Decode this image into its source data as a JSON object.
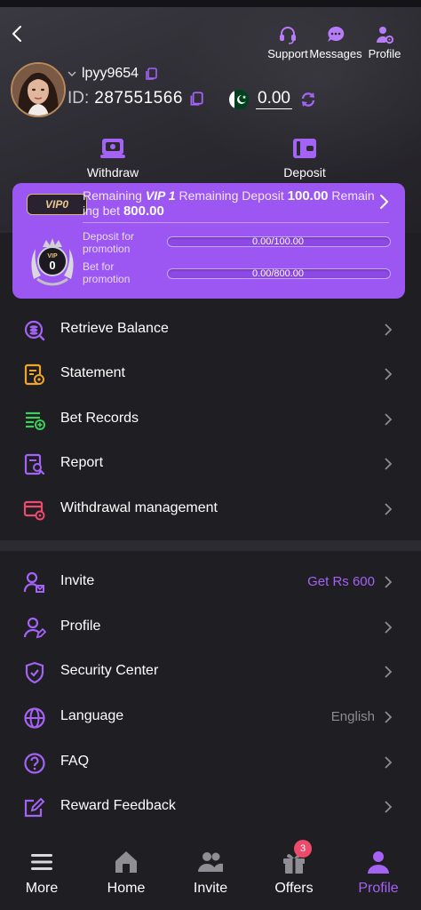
{
  "header": {
    "actions": [
      {
        "label": "Support",
        "icon": "headset-icon"
      },
      {
        "label": "Messages",
        "icon": "chat-bubble-icon"
      },
      {
        "label": "Profile",
        "icon": "user-gear-icon"
      }
    ],
    "username": "lpyy9654",
    "id_label": "ID:",
    "id_value": "287551566",
    "balance": "0.00",
    "quick_actions": [
      {
        "label": "Withdraw",
        "icon": "withdraw-icon"
      },
      {
        "label": "Deposit",
        "icon": "wallet-icon"
      }
    ]
  },
  "vip": {
    "badge": "VIP0",
    "text_remaining": "Remaining",
    "text_level": "VIP 1",
    "text_remaining_deposit": "Remaining Deposit",
    "deposit_amount": "100.00",
    "text_remaining_bet": "Remaining bet",
    "bet_amount": "800.00",
    "emblem_label": "VIP",
    "emblem_level": "0",
    "deposit_label": "Deposit for promotion",
    "deposit_progress": "0.00/100.00",
    "deposit_fraction": 0,
    "bet_label": "Bet for promotion",
    "bet_progress": "0.00/800.00",
    "bet_fraction": 0
  },
  "menu_section_1": [
    {
      "label": "Retrieve Balance",
      "icon": "retrieve-balance-icon",
      "color": "#a463f5"
    },
    {
      "label": "Statement",
      "icon": "statement-icon",
      "color": "#f0a52a"
    },
    {
      "label": "Bet Records",
      "icon": "bet-records-icon",
      "color": "#3ccf5a"
    },
    {
      "label": "Report",
      "icon": "report-icon",
      "color": "#a463f5"
    },
    {
      "label": "Withdrawal management",
      "icon": "withdrawal-management-icon",
      "color": "#ee4a6b"
    }
  ],
  "menu_section_2": [
    {
      "label": "Invite",
      "icon": "invite-icon",
      "right": "Get Rs 600"
    },
    {
      "label": "Profile",
      "icon": "profile-edit-icon",
      "right": ""
    },
    {
      "label": "Security Center",
      "icon": "shield-check-icon",
      "right": ""
    },
    {
      "label": "Language",
      "icon": "globe-icon",
      "right": "English"
    },
    {
      "label": "FAQ",
      "icon": "question-icon",
      "right": ""
    },
    {
      "label": "Reward Feedback",
      "icon": "feedback-edit-icon",
      "right": ""
    }
  ],
  "bottom_nav": [
    {
      "label": "More",
      "icon": "menu-icon"
    },
    {
      "label": "Home",
      "icon": "home-icon"
    },
    {
      "label": "Invite",
      "icon": "people-icon"
    },
    {
      "label": "Offers",
      "icon": "gift-icon"
    },
    {
      "label": "Profile",
      "icon": "user-icon"
    }
  ],
  "offers_badge": "3",
  "colors": {
    "accent": "#a463f5",
    "vip_card": "#9c56f2",
    "background": "#1f1e23",
    "invite_right": "#a463f5",
    "language_right": "#8d8c92"
  }
}
